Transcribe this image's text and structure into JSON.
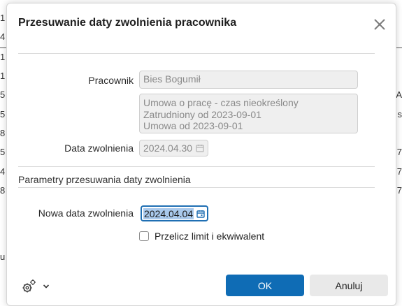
{
  "background": {
    "left_fragments": [
      "1",
      "4",
      "1",
      "1",
      "5",
      "5",
      "8",
      "5",
      "4",
      "8",
      "u"
    ],
    "right_fragments": [
      "s",
      "7",
      "7",
      "7",
      "A"
    ]
  },
  "dialog": {
    "title": "Przesuwanie daty zwolnienia pracownika",
    "close_icon": "close-icon",
    "employee": {
      "label": "Pracownik",
      "value": "Bies Bogumił"
    },
    "contract": {
      "lines": [
        "Umowa o pracę - czas nieokreślony",
        "Zatrudniony od 2023-09-01",
        "Umowa od 2023-09-01"
      ]
    },
    "dismissal_date": {
      "label": "Data zwolnienia",
      "value": "2024.04.30"
    },
    "section_title": "Parametry przesuwania daty zwolnienia",
    "new_dismissal_date": {
      "label": "Nowa data zwolnienia",
      "value": "2024.04.04"
    },
    "recalc_checkbox": {
      "label": "Przelicz limit i ekwiwalent",
      "checked": false
    },
    "footer": {
      "settings_icon": "gear-icon",
      "chevron_icon": "chevron-down-icon",
      "ok_label": "OK",
      "cancel_label": "Anuluj"
    }
  },
  "colors": {
    "primary": "#0f6cb5",
    "selection": "#a9c9ec",
    "readonly_bg": "#efefef"
  }
}
